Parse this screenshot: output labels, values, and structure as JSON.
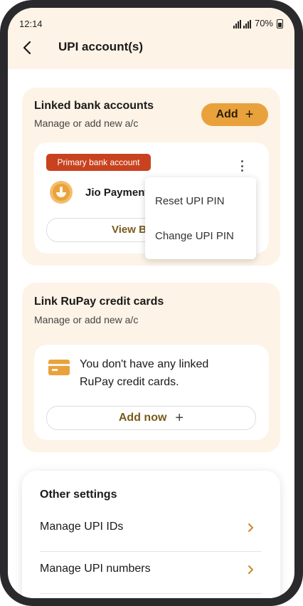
{
  "status": {
    "time": "12:14",
    "battery": "70%"
  },
  "header": {
    "title": "UPI account(s)"
  },
  "linked": {
    "title": "Linked bank accounts",
    "subtitle": "Manage or add new a/c",
    "add_label": "Add",
    "badge": "Primary bank account",
    "bank_name": "Jio Payments Bank",
    "view_label": "View Balance"
  },
  "menu": {
    "items": [
      "Reset UPI PIN",
      "Change UPI PIN"
    ]
  },
  "rupay": {
    "title": "Link RuPay credit cards",
    "subtitle": "Manage or add new a/c",
    "empty_text": "You don't have any linked RuPay credit cards.",
    "add_label": "Add now"
  },
  "settings": {
    "title": "Other settings",
    "items": [
      "Manage UPI IDs",
      "Manage UPI numbers"
    ]
  },
  "colors": {
    "accent": "#e9a23b",
    "badge": "#c9421f",
    "card_bg": "#fdf3e6"
  }
}
